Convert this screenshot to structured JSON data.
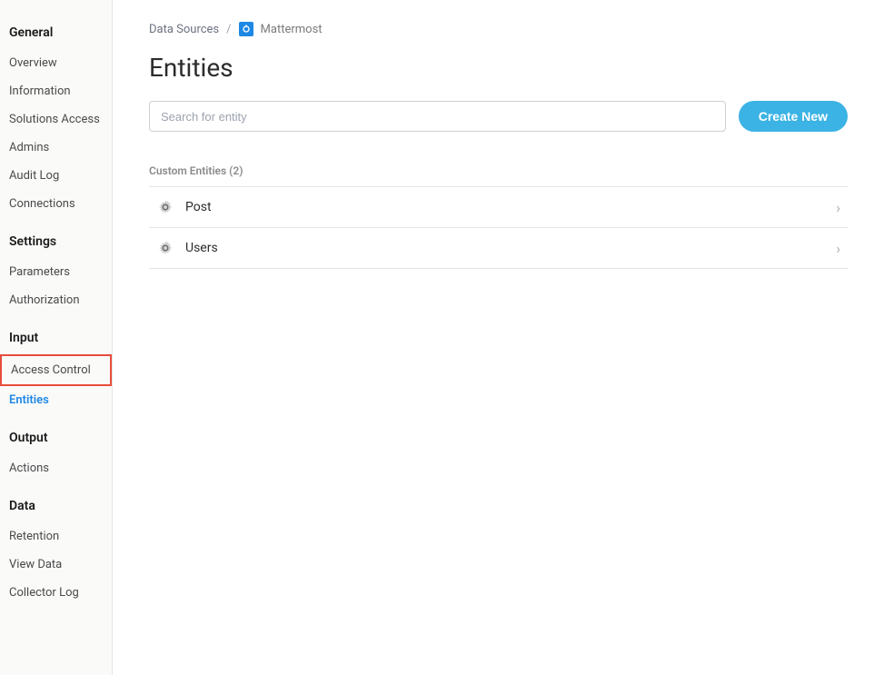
{
  "sidebar": {
    "groups": [
      {
        "header": "General",
        "items": [
          {
            "label": "Overview",
            "active": false
          },
          {
            "label": "Information",
            "active": false
          },
          {
            "label": "Solutions Access",
            "active": false
          },
          {
            "label": "Admins",
            "active": false
          },
          {
            "label": "Audit Log",
            "active": false
          },
          {
            "label": "Connections",
            "active": false
          }
        ]
      },
      {
        "header": "Settings",
        "items": [
          {
            "label": "Parameters",
            "active": false
          },
          {
            "label": "Authorization",
            "active": false
          }
        ]
      },
      {
        "header": "Input",
        "items": [
          {
            "label": "Access Control",
            "active": false,
            "highlighted": true
          },
          {
            "label": "Entities",
            "active": true
          }
        ]
      },
      {
        "header": "Output",
        "items": [
          {
            "label": "Actions",
            "active": false
          }
        ]
      },
      {
        "header": "Data",
        "items": [
          {
            "label": "Retention",
            "active": false
          },
          {
            "label": "View Data",
            "active": false
          },
          {
            "label": "Collector Log",
            "active": false
          }
        ]
      }
    ]
  },
  "breadcrumb": {
    "root": "Data Sources",
    "sep": "/",
    "current": "Mattermost"
  },
  "page": {
    "title": "Entities"
  },
  "search": {
    "placeholder": "Search for entity"
  },
  "create_button": {
    "label": "Create New"
  },
  "entities": {
    "section_label": "Custom Entities (2)",
    "items": [
      {
        "name": "Post"
      },
      {
        "name": "Users"
      }
    ]
  }
}
